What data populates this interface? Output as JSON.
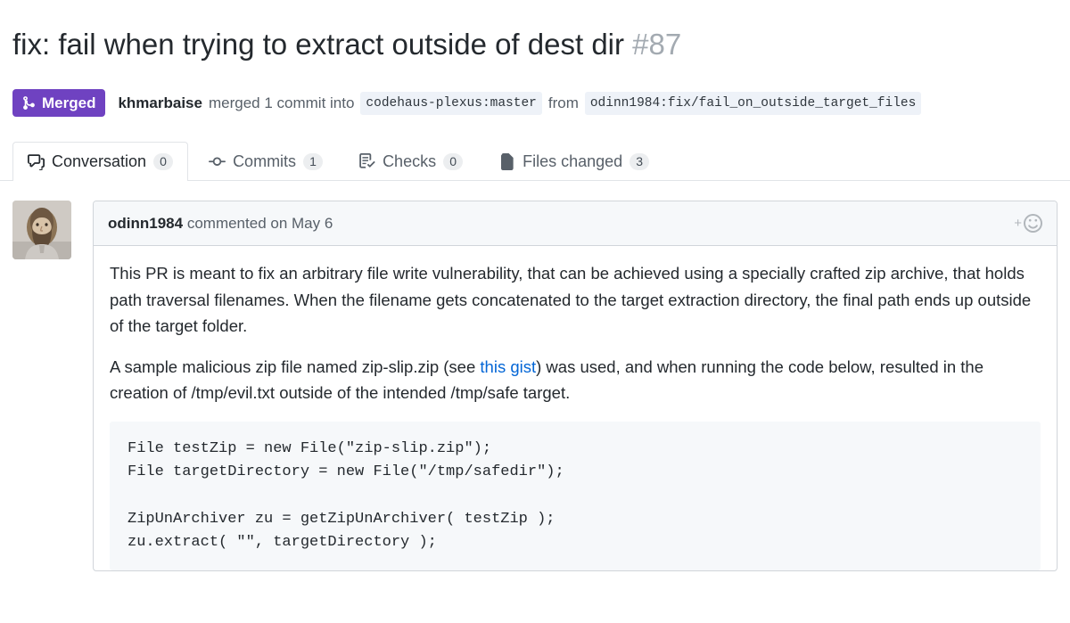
{
  "pull_request": {
    "title": "fix: fail when trying to extract outside of dest dir",
    "number": "#87",
    "state": {
      "label": "Merged",
      "color": "#6f42c1",
      "icon": "git-merge-icon"
    },
    "meta": {
      "actor": "khmarbaise",
      "action_before": "merged 1 commit into",
      "base_branch": "codehaus-plexus:master",
      "connector": "from",
      "head_branch": "odinn1984:fix/fail_on_outside_target_files"
    }
  },
  "tabs": [
    {
      "label": "Conversation",
      "count": "0",
      "icon": "comment-discussion-icon",
      "selected": true
    },
    {
      "label": "Commits",
      "count": "1",
      "icon": "git-commit-icon",
      "selected": false
    },
    {
      "label": "Checks",
      "count": "0",
      "icon": "checklist-icon",
      "selected": false
    },
    {
      "label": "Files changed",
      "count": "3",
      "icon": "file-diff-icon",
      "selected": false
    }
  ],
  "comment": {
    "avatar_alt": "odinn1984 avatar",
    "author": "odinn1984",
    "action": "commented on",
    "date": "May 6",
    "reaction_add": "+",
    "reaction_icon": "smiley-icon",
    "paragraph_1": "This PR is meant to fix an arbitrary file write vulnerability, that can be achieved using a specially crafted zip archive, that holds path traversal filenames. When the filename gets concatenated to the target extraction directory, the final path ends up outside of the target folder.",
    "paragraph_2_before_link": "A sample malicious zip file named zip-slip.zip (see ",
    "link_text": "this gist",
    "paragraph_2_after_link": ") was used, and when running the code below, resulted in the creation of /tmp/evil.txt outside of the intended /tmp/safe target.",
    "code": "File testZip = new File(\"zip-slip.zip\");\nFile targetDirectory = new File(\"/tmp/safedir\");\n\nZipUnArchiver zu = getZipUnArchiver( testZip );\nzu.extract( \"\", targetDirectory );"
  },
  "colors": {
    "merged_purple": "#6f42c1",
    "link_blue": "#0366d6",
    "muted_text": "#586069",
    "number_grey": "#a3aab1",
    "code_bg": "#f6f8fa",
    "border": "#d1d5da"
  }
}
